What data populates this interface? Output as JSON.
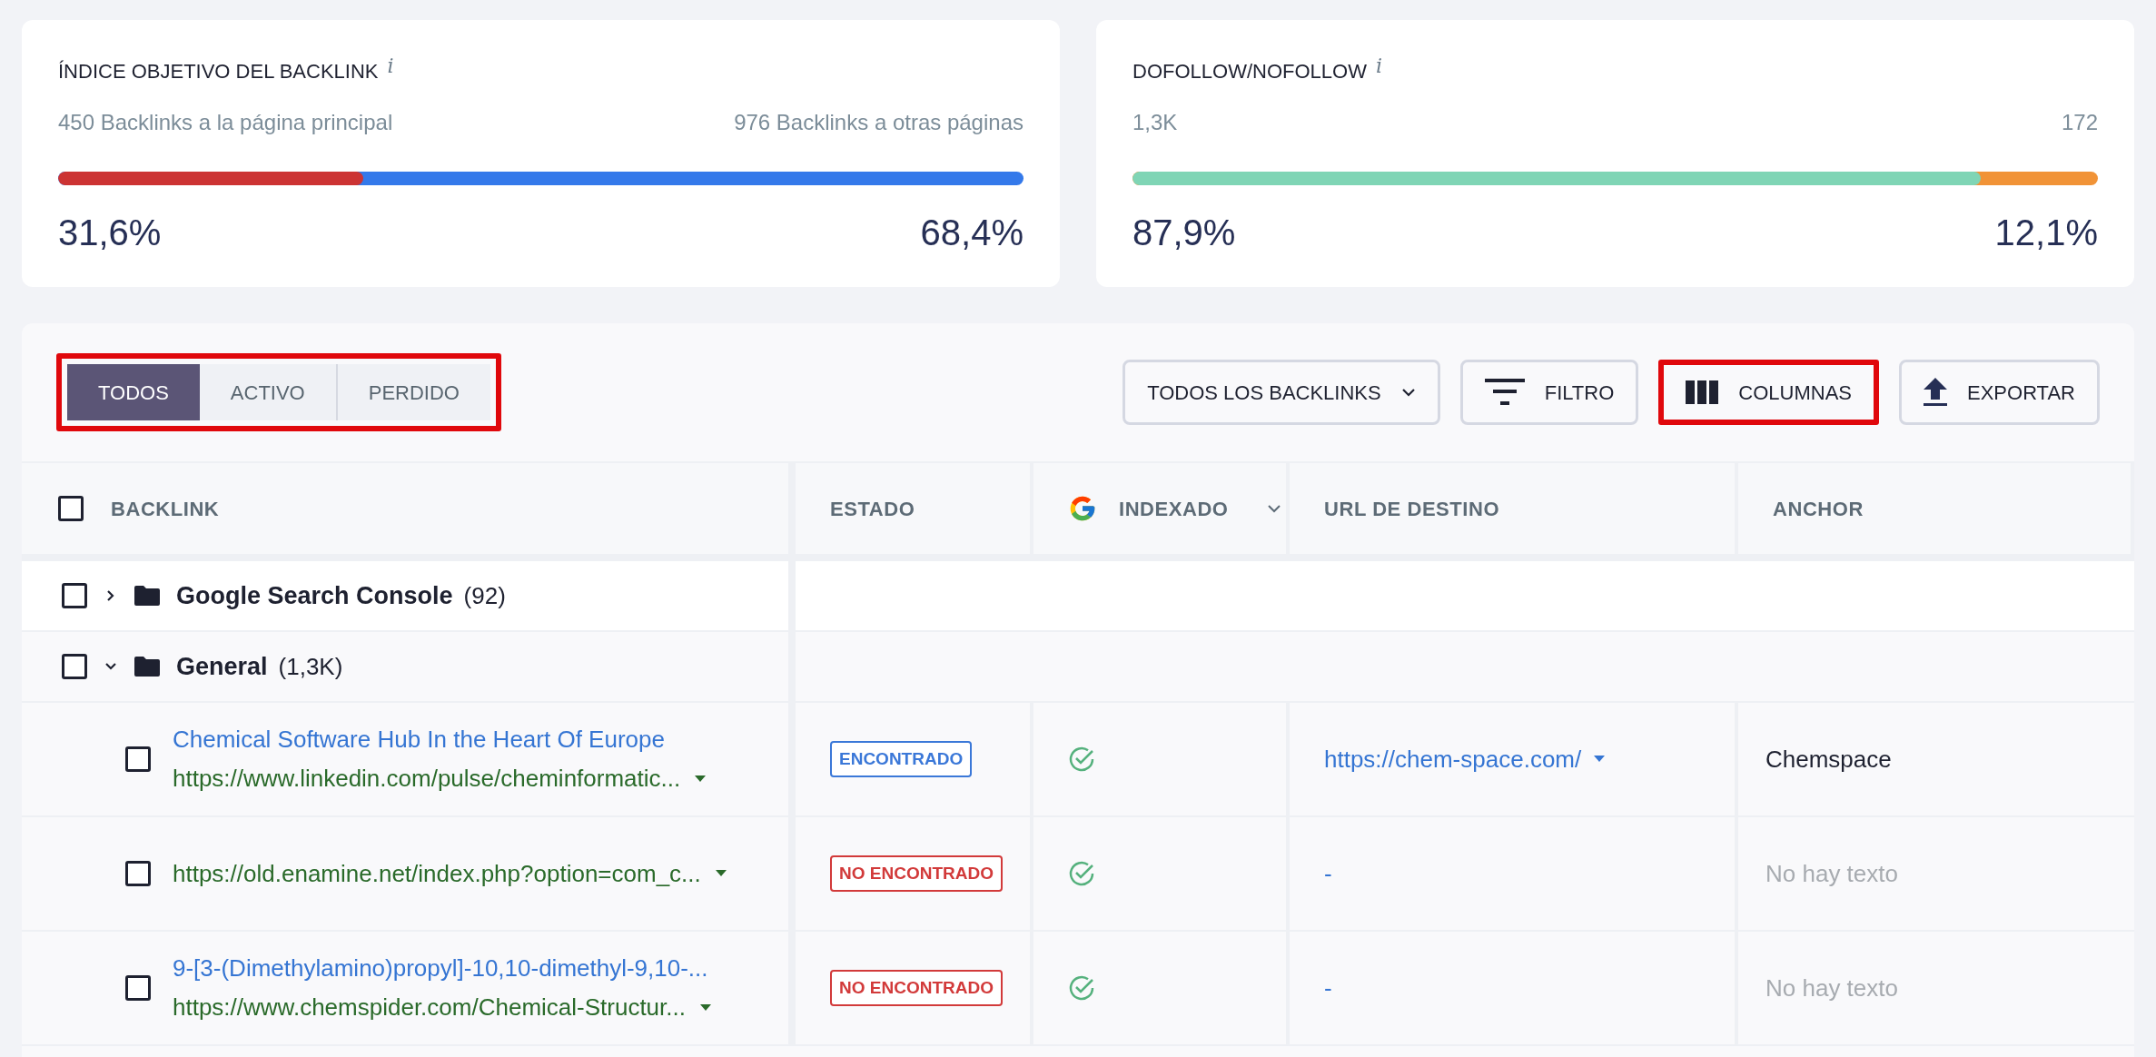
{
  "cards": [
    {
      "title": "ÍNDICE OBJETIVO DEL BACKLINK",
      "info": "i",
      "left_label": "450 Backlinks a la página principal",
      "right_label": "976 Backlinks a otras páginas",
      "level": 0.316,
      "left_value": "31,6%",
      "right_value": "68,4%"
    },
    {
      "title": "DOFOLLOW/NOFOLLOW",
      "info": "i",
      "left_label": "1,3K",
      "right_label": "172",
      "level": 0.879,
      "left_value": "87,9%",
      "right_value": "12,1%"
    }
  ],
  "tabs": {
    "highlighted": true,
    "items": [
      {
        "label": "TODOS",
        "selected": true
      },
      {
        "label": "ACTIVO",
        "selected": false
      },
      {
        "label": "PERDIDO",
        "selected": false
      }
    ]
  },
  "toolbar": [
    {
      "kind": "dropdown",
      "label": "TODOS LOS BACKLINKS",
      "highlighted": false
    },
    {
      "kind": "filter",
      "label": "FILTRO",
      "highlighted": false
    },
    {
      "kind": "columns",
      "label": "COLUMNAS",
      "highlighted": true
    },
    {
      "kind": "export",
      "label": "EXPORTAR",
      "highlighted": false
    }
  ],
  "table": {
    "select_all_checked": false,
    "columns": [
      {
        "label": "BACKLINK"
      },
      {
        "label": "ESTADO"
      },
      {
        "label": "INDEXADO"
      },
      {
        "label": "URL DE DESTINO"
      },
      {
        "label": "ANCHOR"
      }
    ],
    "groups": [
      {
        "name": "Google Search Console",
        "count": "(92)",
        "checked": false,
        "expanded": false
      },
      {
        "name": "General",
        "count": "(1,3K)",
        "checked": false,
        "expanded": true
      }
    ],
    "rows": [
      {
        "checked": false,
        "title": "Chemical Software Hub In the Heart Of Europe",
        "url": "https://www.linkedin.com/pulse/cheminformatic...",
        "status": {
          "kind": "found",
          "label": "ENCONTRADO"
        },
        "indexed": true,
        "target": "https://chem-space.com/",
        "target_has_menu": true,
        "anchor": "Chemspace",
        "anchor_empty": false
      },
      {
        "checked": false,
        "url": "https://old.enamine.net/index.php?option=com_c...",
        "status": {
          "kind": "not_found",
          "label": "NO ENCONTRADO"
        },
        "indexed": true,
        "target": "-",
        "target_has_menu": false,
        "anchor": "No hay texto",
        "anchor_empty": true
      },
      {
        "checked": false,
        "title": "9-[3-(Dimethylamino)propyl]-10,10-dimethyl-9,10-...",
        "url": "https://www.chemspider.com/Chemical-Structur...",
        "status": {
          "kind": "not_found",
          "label": "NO ENCONTRADO"
        },
        "indexed": true,
        "target": "-",
        "target_has_menu": false,
        "anchor": "No hay texto",
        "anchor_empty": true
      }
    ]
  }
}
